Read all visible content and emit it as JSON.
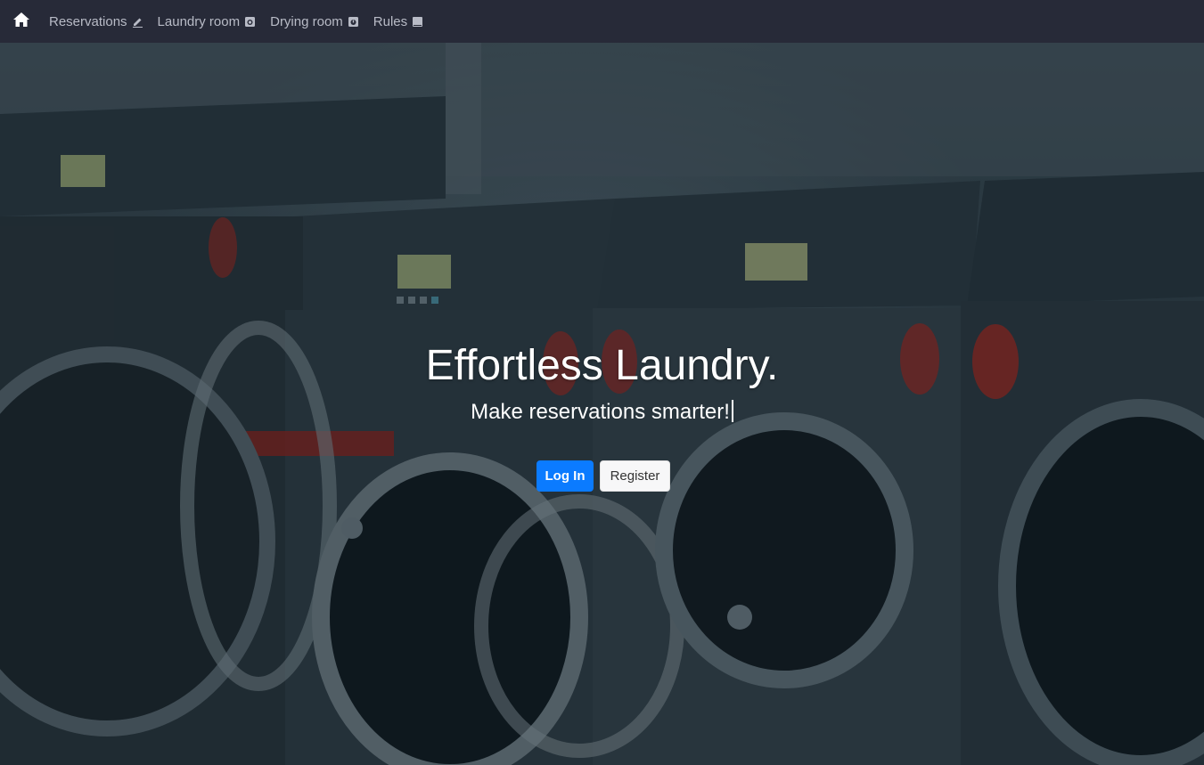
{
  "nav": {
    "home_icon": "home-icon",
    "links": [
      {
        "label": "Reservations",
        "icon": "pencil-icon"
      },
      {
        "label": "Laundry room",
        "icon": "washer-icon"
      },
      {
        "label": "Drying room",
        "icon": "dryer-icon"
      },
      {
        "label": "Rules",
        "icon": "book-icon"
      }
    ]
  },
  "hero": {
    "title": "Effortless Laundry.",
    "subtitle": "Make reservations smarter!",
    "login_label": "Log In",
    "register_label": "Register"
  },
  "colors": {
    "navbar_bg": "#272a38",
    "primary": "#0b7bff",
    "nav_text": "#b8bbc6"
  }
}
